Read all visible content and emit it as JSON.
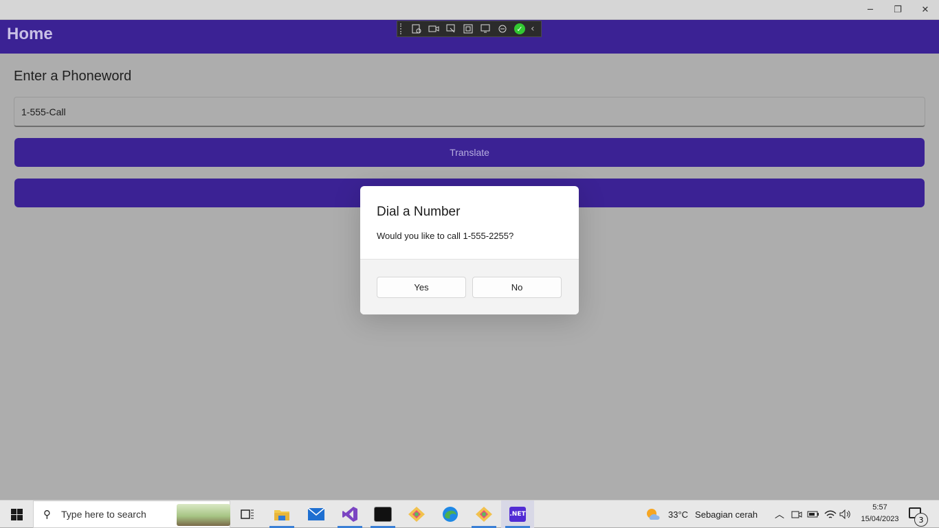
{
  "window": {
    "controls": {
      "minimize": "─",
      "maximize": "❐",
      "close": "✕"
    }
  },
  "app": {
    "header_title": "Home",
    "prompt_label": "Enter a Phoneword",
    "phone_input_value": "1-555-Call",
    "translate_button": "Translate",
    "call_button": ""
  },
  "dialog": {
    "title": "Dial a Number",
    "message": "Would you like to call 1-555-2255?",
    "yes_label": "Yes",
    "no_label": "No"
  },
  "taskbar": {
    "search_placeholder": "Type here to search",
    "apps": [
      {
        "name": "task-view",
        "icon": "task-view-icon"
      },
      {
        "name": "file-explorer",
        "icon": "folder-icon"
      },
      {
        "name": "mail",
        "icon": "mail-icon"
      },
      {
        "name": "visual-studio",
        "icon": "visual-studio-icon"
      },
      {
        "name": "terminal",
        "icon": "terminal-icon"
      },
      {
        "name": "git-app",
        "icon": "git-icon"
      },
      {
        "name": "edge",
        "icon": "edge-icon"
      },
      {
        "name": "git-app-2",
        "icon": "git-icon"
      },
      {
        "name": "dotnet-app",
        "icon": "dotnet-icon",
        "label": ".NET"
      }
    ],
    "weather": {
      "temp": "33°C",
      "condition": "Sebagian cerah"
    },
    "clock": {
      "time": "5:57",
      "date": "15/04/2023"
    },
    "notification_count": "3"
  },
  "colors": {
    "header": "#3b2294",
    "button": "#3b2294",
    "button_text": "#b7aee0",
    "background_dim": "#adadad"
  }
}
